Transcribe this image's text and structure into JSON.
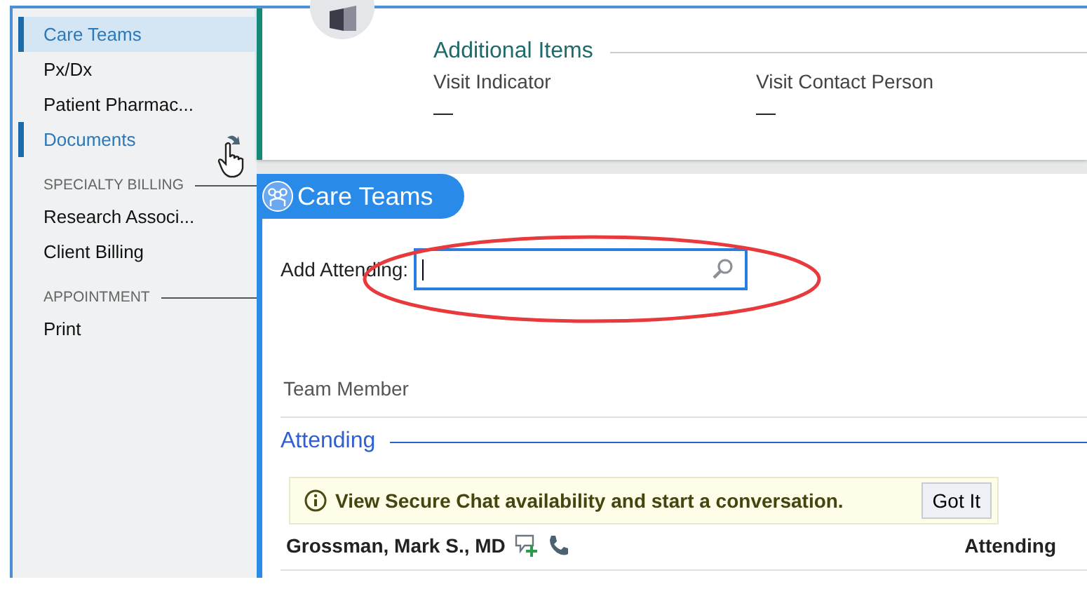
{
  "sidebar": {
    "items": [
      {
        "kind": "item",
        "label": "Care Teams",
        "selected": true,
        "marked": true,
        "has_link": false
      },
      {
        "kind": "item",
        "label": "Px/Dx",
        "selected": false,
        "marked": false,
        "has_link": false
      },
      {
        "kind": "item",
        "label": "Patient Pharmac...",
        "selected": false,
        "marked": false,
        "has_link": false
      },
      {
        "kind": "item",
        "label": "Documents",
        "selected": false,
        "marked": true,
        "has_link": true
      },
      {
        "kind": "header",
        "label": "SPECIALTY BILLING"
      },
      {
        "kind": "item",
        "label": "Research Associ...",
        "selected": false,
        "marked": false,
        "has_link": false
      },
      {
        "kind": "item",
        "label": "Client Billing",
        "selected": false,
        "marked": false,
        "has_link": false
      },
      {
        "kind": "header",
        "label": "APPOINTMENT"
      },
      {
        "kind": "item",
        "label": "Print",
        "selected": false,
        "marked": false,
        "has_link": false
      }
    ]
  },
  "additional_items": {
    "title": "Additional Items",
    "fields": [
      {
        "label": "Visit Indicator",
        "value": "—"
      },
      {
        "label": "Visit Contact Person",
        "value": "—"
      }
    ]
  },
  "care_teams": {
    "title": "Care Teams",
    "add_attending_label": "Add Attending:",
    "column_header": "Team Member",
    "group": "Attending",
    "notice": {
      "text": "View Secure Chat availability and start a conversation.",
      "button": "Got It"
    },
    "members": [
      {
        "name": "Grossman, Mark S., MD",
        "role": "Attending"
      }
    ]
  }
}
